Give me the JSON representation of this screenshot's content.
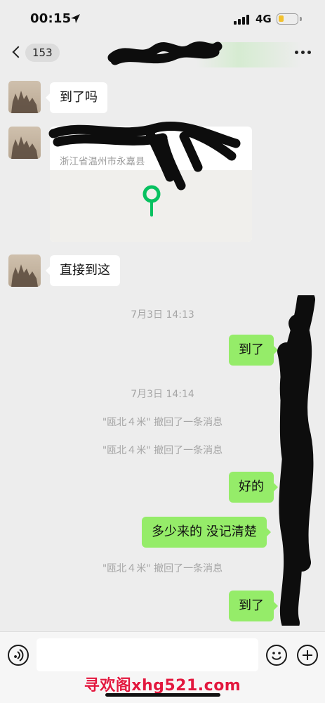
{
  "status_bar": {
    "time": "00:15",
    "network": "4G",
    "icons": [
      "location-arrow-icon",
      "signal-bars-icon",
      "battery-icon"
    ]
  },
  "nav": {
    "back_badge": "153",
    "icons": [
      "chevron-left-icon",
      "more-dots-icon"
    ]
  },
  "messages": [
    {
      "side": "in",
      "type": "text",
      "text": "到了吗"
    },
    {
      "side": "in",
      "type": "location",
      "address": "浙江省温州市永嘉县"
    },
    {
      "side": "in",
      "type": "text",
      "text": "直接到这"
    },
    {
      "type": "time",
      "text": "7月3日 14:13"
    },
    {
      "side": "out",
      "type": "text",
      "text": "到了"
    },
    {
      "type": "time",
      "text": "7月3日 14:14"
    },
    {
      "type": "recall",
      "text": "\"瓯北４米\" 撤回了一条消息"
    },
    {
      "type": "recall",
      "text": "\"瓯北４米\" 撤回了一条消息"
    },
    {
      "side": "out",
      "type": "text",
      "text": "好的"
    },
    {
      "side": "out",
      "type": "text",
      "text": "多少来的 没记清楚"
    },
    {
      "type": "recall",
      "text": "\"瓯北４米\" 撤回了一条消息"
    },
    {
      "side": "out",
      "type": "text",
      "text": "到了"
    }
  ],
  "input_bar": {
    "icons": [
      "voice-icon",
      "emoji-icon",
      "plus-icon"
    ]
  },
  "watermark": "寻欢阁xhg521.com",
  "colors": {
    "background": "#ededed",
    "outgoing_bubble": "#95ec69",
    "incoming_bubble": "#ffffff",
    "map_pin": "#07c160",
    "watermark": "#e2183e"
  }
}
